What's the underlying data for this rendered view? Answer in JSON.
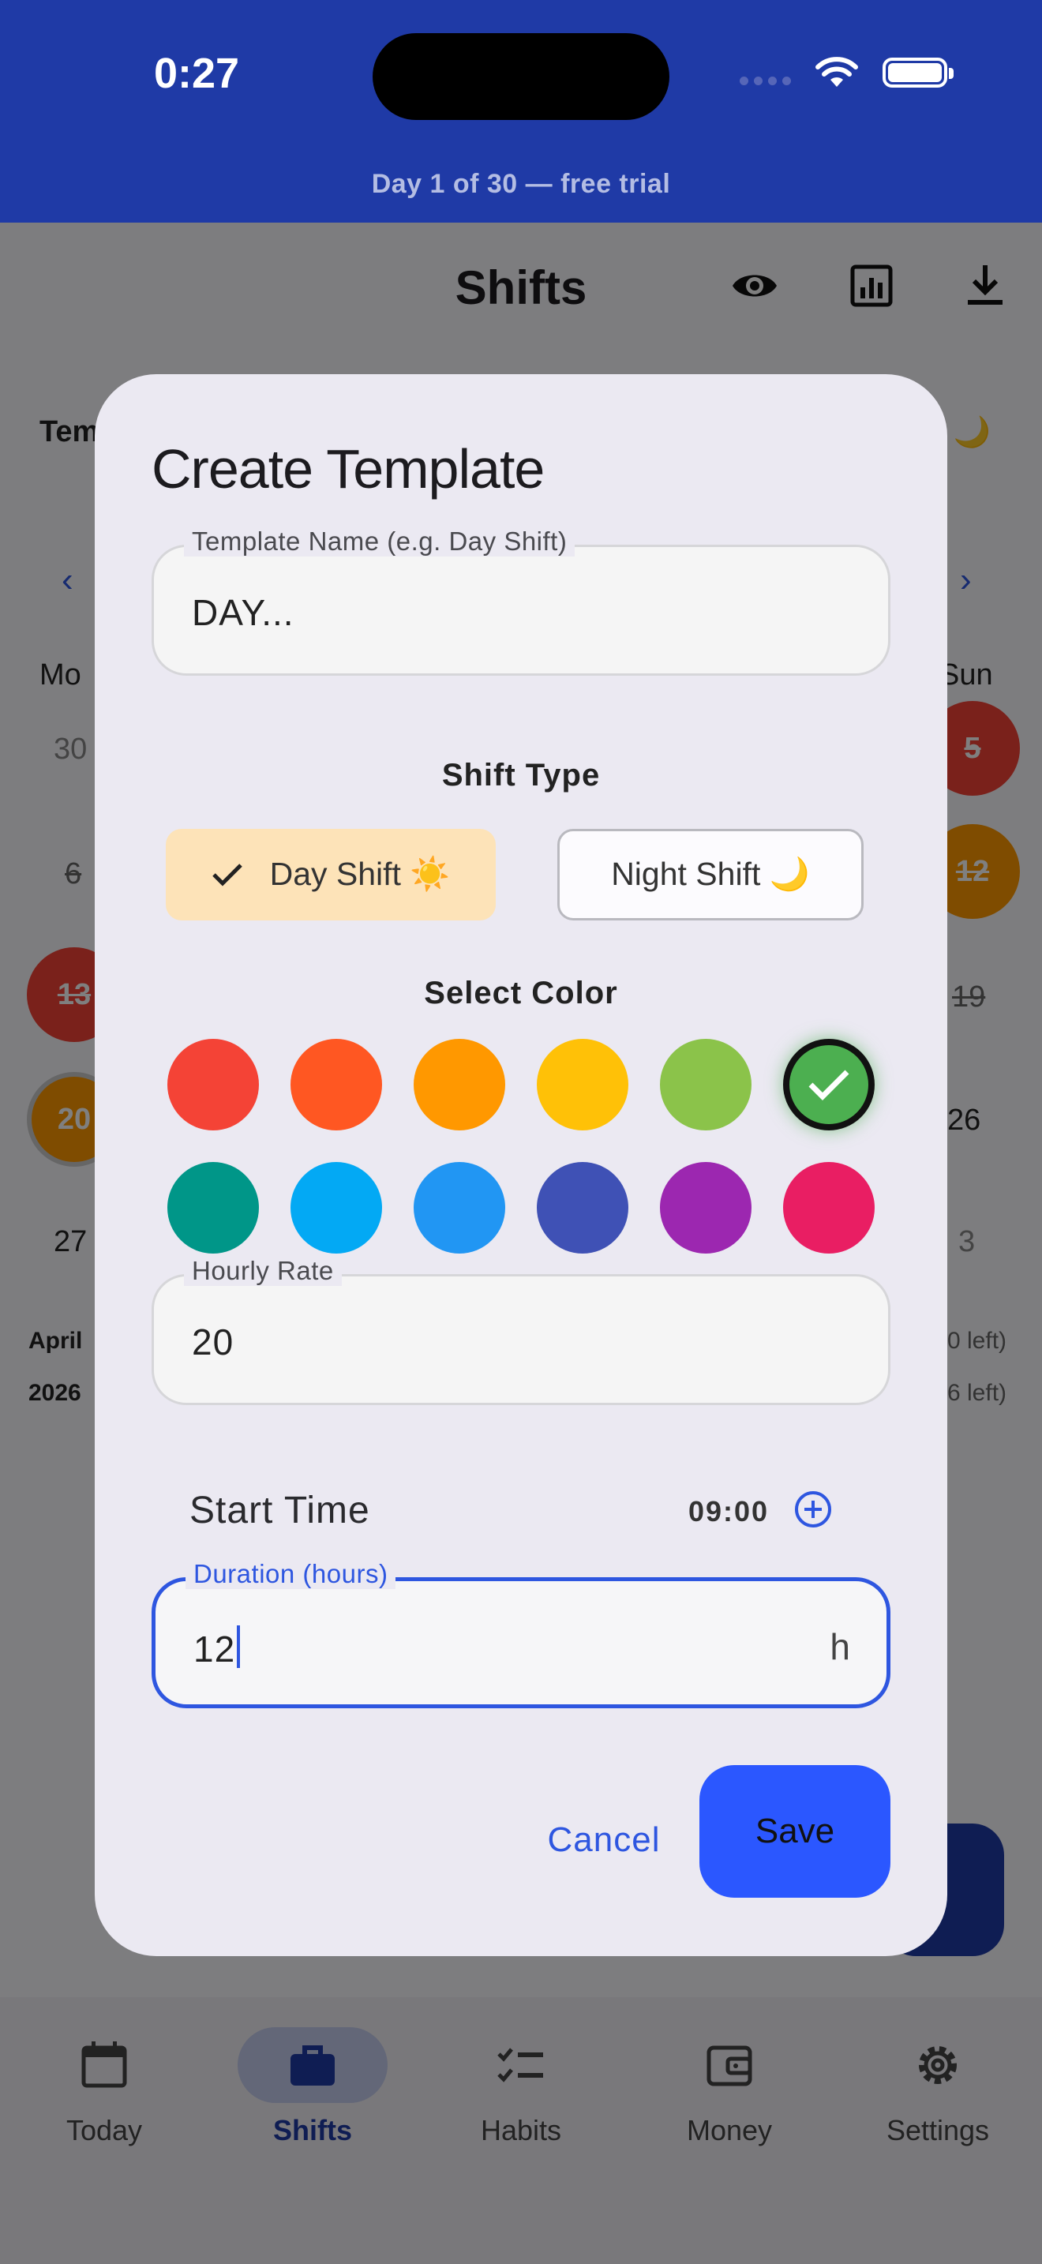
{
  "status_bar": {
    "time": "0:27"
  },
  "trial_banner": "Day 1 of 30 — free trial",
  "app": {
    "title": "Shifts",
    "top_actions": [
      "eye-icon",
      "chart-icon",
      "download-icon"
    ]
  },
  "background": {
    "tabs_left": "Tem",
    "tabs_right": "ft 🌙",
    "weekday_left": "Mo",
    "weekday_right": "Sun",
    "dates_left": [
      "30",
      "6",
      "13",
      "20",
      "27"
    ],
    "dates_right": [
      "5",
      "12",
      "19",
      "26",
      "3"
    ],
    "footer_left": [
      "April",
      "2026"
    ],
    "footer_right": [
      "0 left)",
      "6 left)"
    ]
  },
  "dialog": {
    "title": "Create Template",
    "name_field": {
      "label": "Template Name (e.g. Day Shift)",
      "value": "DAY..."
    },
    "shift_type": {
      "title": "Shift Type",
      "options": [
        "Day Shift ☀️",
        "Night Shift 🌙"
      ],
      "selected": "Day Shift ☀️"
    },
    "color": {
      "title": "Select Color",
      "swatches": [
        "#f44336",
        "#ff5722",
        "#ff9800",
        "#ffc107",
        "#8bc34a",
        "#4caf50",
        "#009688",
        "#03a9f4",
        "#2196f3",
        "#3f51b5",
        "#9c27b0",
        "#e91e63"
      ],
      "selected": "#4caf50"
    },
    "rate_field": {
      "label": "Hourly Rate",
      "value": "20"
    },
    "start_time": {
      "label": "Start Time",
      "value": "09:00"
    },
    "duration_field": {
      "label": "Duration (hours)",
      "value": "12",
      "suffix": "h"
    },
    "cancel": "Cancel",
    "save": "Save"
  },
  "bottom_nav": {
    "items": [
      {
        "label": "Today",
        "icon": "calendar-icon"
      },
      {
        "label": "Shifts",
        "icon": "briefcase-icon"
      },
      {
        "label": "Habits",
        "icon": "checklist-icon"
      },
      {
        "label": "Money",
        "icon": "wallet-icon"
      },
      {
        "label": "Settings",
        "icon": "gear-icon"
      }
    ],
    "active": "Shifts"
  }
}
